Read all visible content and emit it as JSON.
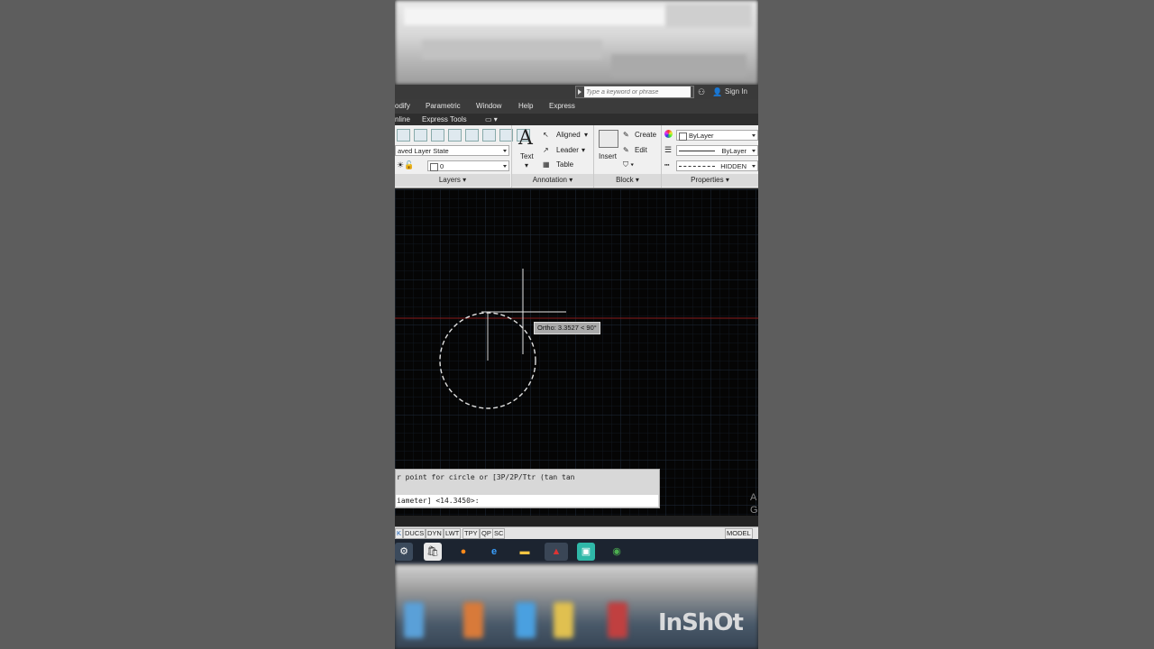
{
  "search": {
    "placeholder": "Type a keyword or phrase"
  },
  "titlebar": {
    "signin": "Sign In"
  },
  "menu": [
    "odify",
    "Parametric",
    "Window",
    "Help",
    "Express"
  ],
  "tabs": [
    "nline",
    "Express Tools"
  ],
  "ribbon": {
    "layer_state": "aved Layer State",
    "layer_name": "0",
    "text_label": "Text",
    "aligned": "Aligned",
    "leader": "Leader",
    "table": "Table",
    "insert": "Insert",
    "create": "Create",
    "edit": "Edit",
    "color": "ByLayer",
    "linetype": "ByLayer",
    "lineweight": "HIDDEN",
    "panels": {
      "layers": "Layers",
      "annotation": "Annotation",
      "block": "Block",
      "properties": "Properties"
    }
  },
  "canvas": {
    "tooltip": "Ortho: 3.3527 < 90°",
    "command_line1": "r point for circle or [3P/2P/Ttr (tan tan",
    "command_line2": "iameter] <14.3450>:",
    "corner_a": "A",
    "corner_g": "G"
  },
  "statusbar": [
    "K",
    "DUCS",
    "DYN",
    "LWT",
    "TPY",
    "QP",
    "SC"
  ],
  "model_label": "MODEL",
  "watermark": "InShOt",
  "colors": {
    "accent_grid": "#1e2a3a",
    "ucs_red": "#8b1a1a",
    "taskbar": "#1c2430"
  }
}
